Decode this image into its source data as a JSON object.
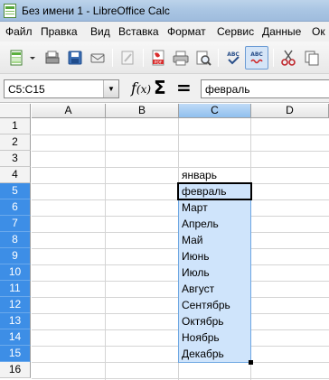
{
  "window": {
    "title": "Без имени 1 - LibreOffice Calc"
  },
  "menu": [
    "Файл",
    "Правка",
    "Вид",
    "Вставка",
    "Формат",
    "Сервис",
    "Данные",
    "Ок"
  ],
  "formula_bar": {
    "name_box": "C5:C15",
    "input": "февраль"
  },
  "columns": [
    "A",
    "B",
    "C",
    "D"
  ],
  "rows": [
    "1",
    "2",
    "3",
    "4",
    "5",
    "6",
    "7",
    "8",
    "9",
    "10",
    "11",
    "12",
    "13",
    "14",
    "15",
    "16"
  ],
  "cells_C": [
    {
      "row": "4",
      "value": "январь"
    },
    {
      "row": "5",
      "value": "февраль"
    },
    {
      "row": "6",
      "value": "Март"
    },
    {
      "row": "7",
      "value": "Апрель"
    },
    {
      "row": "8",
      "value": "Май"
    },
    {
      "row": "9",
      "value": "Июнь"
    },
    {
      "row": "10",
      "value": "Июль"
    },
    {
      "row": "11",
      "value": "Август"
    },
    {
      "row": "12",
      "value": "Сентябрь"
    },
    {
      "row": "13",
      "value": "Октябрь"
    },
    {
      "row": "14",
      "value": "Ноябрь"
    },
    {
      "row": "15",
      "value": "Декабрь"
    }
  ],
  "selection": {
    "range": "C5:C15",
    "active_cell": "C5"
  },
  "colors": {
    "selection_fill": "#cfe4fb",
    "selected_header": "#3d8ee6",
    "titlebar": "#a9c5e3"
  },
  "toolbar_icons": [
    "new-icon",
    "dropdown-icon",
    "open-icon",
    "save-icon",
    "email-icon",
    "edit-file-icon",
    "export-pdf-icon",
    "print-icon",
    "print-preview-icon",
    "spellcheck-icon",
    "autospellcheck-icon",
    "cut-icon",
    "copy-icon"
  ]
}
